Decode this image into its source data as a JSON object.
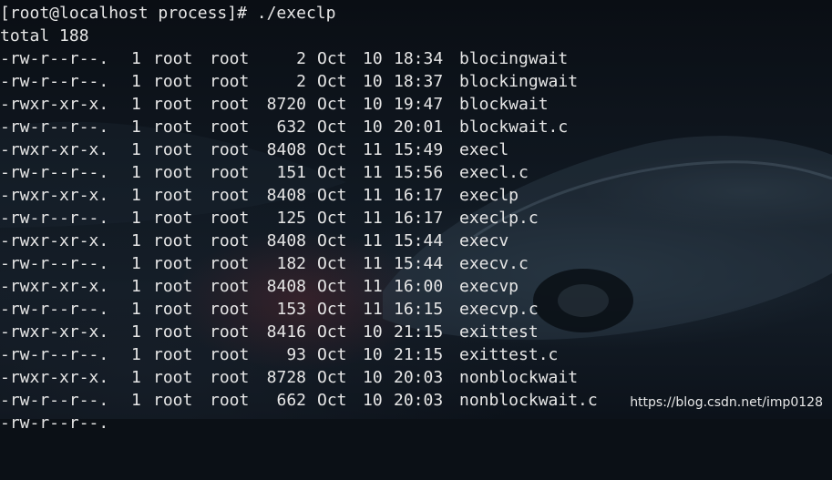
{
  "terminal": {
    "prompt": "[root@localhost process]# ./execlp",
    "total": "total 188",
    "rows": [
      {
        "perm": "-rw-r--r--.",
        "links": "1",
        "owner": "root",
        "group": "root",
        "size": "2",
        "month": "Oct",
        "day": "10",
        "time": "18:34",
        "name": "blocingwait"
      },
      {
        "perm": "-rw-r--r--.",
        "links": "1",
        "owner": "root",
        "group": "root",
        "size": "2",
        "month": "Oct",
        "day": "10",
        "time": "18:37",
        "name": "blockingwait"
      },
      {
        "perm": "-rwxr-xr-x.",
        "links": "1",
        "owner": "root",
        "group": "root",
        "size": "8720",
        "month": "Oct",
        "day": "10",
        "time": "19:47",
        "name": "blockwait"
      },
      {
        "perm": "-rw-r--r--.",
        "links": "1",
        "owner": "root",
        "group": "root",
        "size": "632",
        "month": "Oct",
        "day": "10",
        "time": "20:01",
        "name": "blockwait.c"
      },
      {
        "perm": "-rwxr-xr-x.",
        "links": "1",
        "owner": "root",
        "group": "root",
        "size": "8408",
        "month": "Oct",
        "day": "11",
        "time": "15:49",
        "name": "execl"
      },
      {
        "perm": "-rw-r--r--.",
        "links": "1",
        "owner": "root",
        "group": "root",
        "size": "151",
        "month": "Oct",
        "day": "11",
        "time": "15:56",
        "name": "execl.c"
      },
      {
        "perm": "-rwxr-xr-x.",
        "links": "1",
        "owner": "root",
        "group": "root",
        "size": "8408",
        "month": "Oct",
        "day": "11",
        "time": "16:17",
        "name": "execlp"
      },
      {
        "perm": "-rw-r--r--.",
        "links": "1",
        "owner": "root",
        "group": "root",
        "size": "125",
        "month": "Oct",
        "day": "11",
        "time": "16:17",
        "name": "execlp.c"
      },
      {
        "perm": "-rwxr-xr-x.",
        "links": "1",
        "owner": "root",
        "group": "root",
        "size": "8408",
        "month": "Oct",
        "day": "11",
        "time": "15:44",
        "name": "execv"
      },
      {
        "perm": "-rw-r--r--.",
        "links": "1",
        "owner": "root",
        "group": "root",
        "size": "182",
        "month": "Oct",
        "day": "11",
        "time": "15:44",
        "name": "execv.c"
      },
      {
        "perm": "-rwxr-xr-x.",
        "links": "1",
        "owner": "root",
        "group": "root",
        "size": "8408",
        "month": "Oct",
        "day": "11",
        "time": "16:00",
        "name": "execvp"
      },
      {
        "perm": "-rw-r--r--.",
        "links": "1",
        "owner": "root",
        "group": "root",
        "size": "153",
        "month": "Oct",
        "day": "11",
        "time": "16:15",
        "name": "execvp.c"
      },
      {
        "perm": "-rwxr-xr-x.",
        "links": "1",
        "owner": "root",
        "group": "root",
        "size": "8416",
        "month": "Oct",
        "day": "10",
        "time": "21:15",
        "name": "exittest"
      },
      {
        "perm": "-rw-r--r--.",
        "links": "1",
        "owner": "root",
        "group": "root",
        "size": "93",
        "month": "Oct",
        "day": "10",
        "time": "21:15",
        "name": "exittest.c"
      },
      {
        "perm": "-rwxr-xr-x.",
        "links": "1",
        "owner": "root",
        "group": "root",
        "size": "8728",
        "month": "Oct",
        "day": "10",
        "time": "20:03",
        "name": "nonblockwait"
      },
      {
        "perm": "-rw-r--r--.",
        "links": "1",
        "owner": "root",
        "group": "root",
        "size": "662",
        "month": "Oct",
        "day": "10",
        "time": "20:03",
        "name": "nonblockwait.c"
      }
    ]
  },
  "watermark": "https://blog.csdn.net/imp0128",
  "colors": {
    "text": "#e6e6e6",
    "background": "#0b1016"
  }
}
